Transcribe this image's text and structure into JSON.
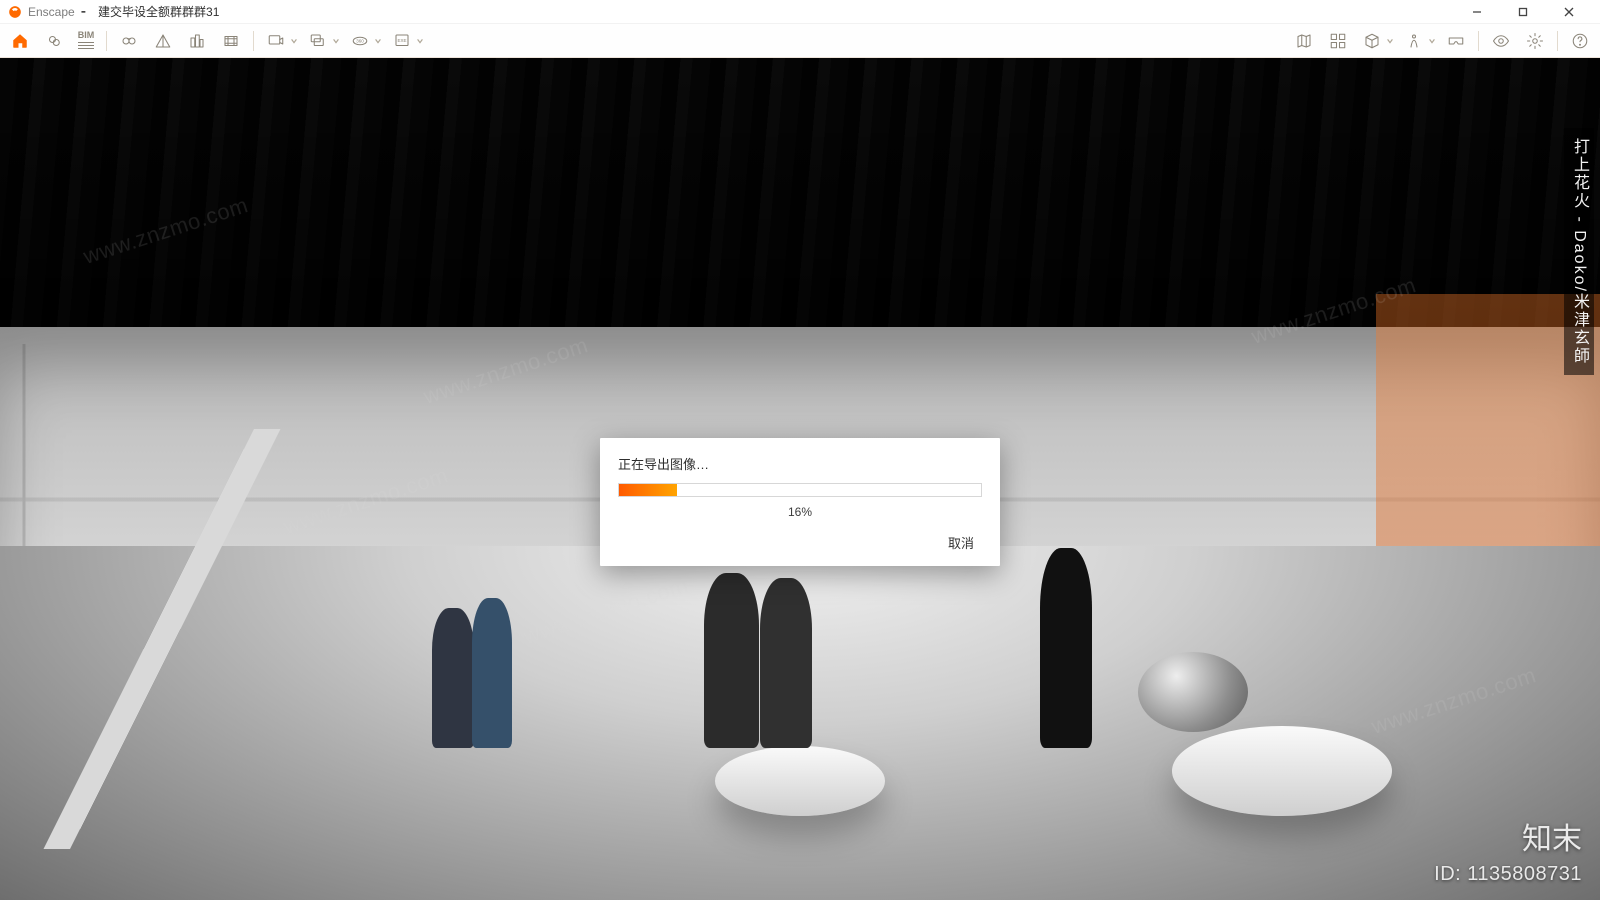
{
  "window": {
    "app_name": "Enscape",
    "sep": " - ",
    "doc_title": "建交毕设全额群群群31"
  },
  "toolbar": {
    "bim_label": "BIM"
  },
  "dialog": {
    "title": "正在导出图像…",
    "percent_value": 16,
    "percent_text": "16%",
    "cancel": "取消"
  },
  "overlay": {
    "watermark": "www.znzmo.com",
    "brand": "知末",
    "id_label": "ID: 1135808731",
    "side_caption": "打上花火 - Daoko/米津玄師"
  },
  "colors": {
    "accent": "#ff6a00"
  }
}
